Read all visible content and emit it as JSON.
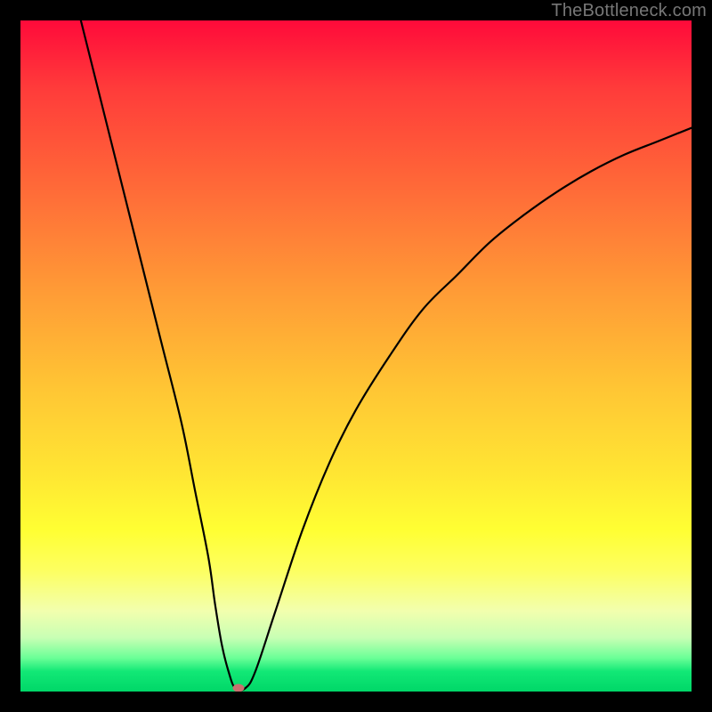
{
  "watermark": "TheBottleneck.com",
  "chart_data": {
    "type": "line",
    "title": "",
    "xlabel": "",
    "ylabel": "",
    "xlim": [
      0,
      100
    ],
    "ylim": [
      0,
      100
    ],
    "grid": false,
    "legend": false,
    "series": [
      {
        "name": "curve",
        "x": [
          9,
          12,
          15,
          18,
          21,
          24,
          26,
          28,
          29,
          30,
          31,
          32,
          33.5,
          35,
          38,
          42,
          46,
          50,
          55,
          60,
          65,
          70,
          75,
          80,
          85,
          90,
          95,
          100
        ],
        "values": [
          100,
          88,
          76,
          64,
          52,
          40,
          30,
          20,
          13,
          7,
          3,
          0.5,
          0.5,
          3,
          12,
          24,
          34,
          42,
          50,
          57,
          62,
          67,
          71,
          74.5,
          77.5,
          80,
          82,
          84
        ]
      }
    ],
    "marker": {
      "x": 32.5,
      "y": 0.5
    },
    "background_gradient": {
      "stops": [
        {
          "pos": 0,
          "color": "#ff0a3a"
        },
        {
          "pos": 25,
          "color": "#ff6a38"
        },
        {
          "pos": 55,
          "color": "#ffc634"
        },
        {
          "pos": 76,
          "color": "#ffff33"
        },
        {
          "pos": 92,
          "color": "#c8ffb4"
        },
        {
          "pos": 100,
          "color": "#00d768"
        }
      ]
    }
  }
}
